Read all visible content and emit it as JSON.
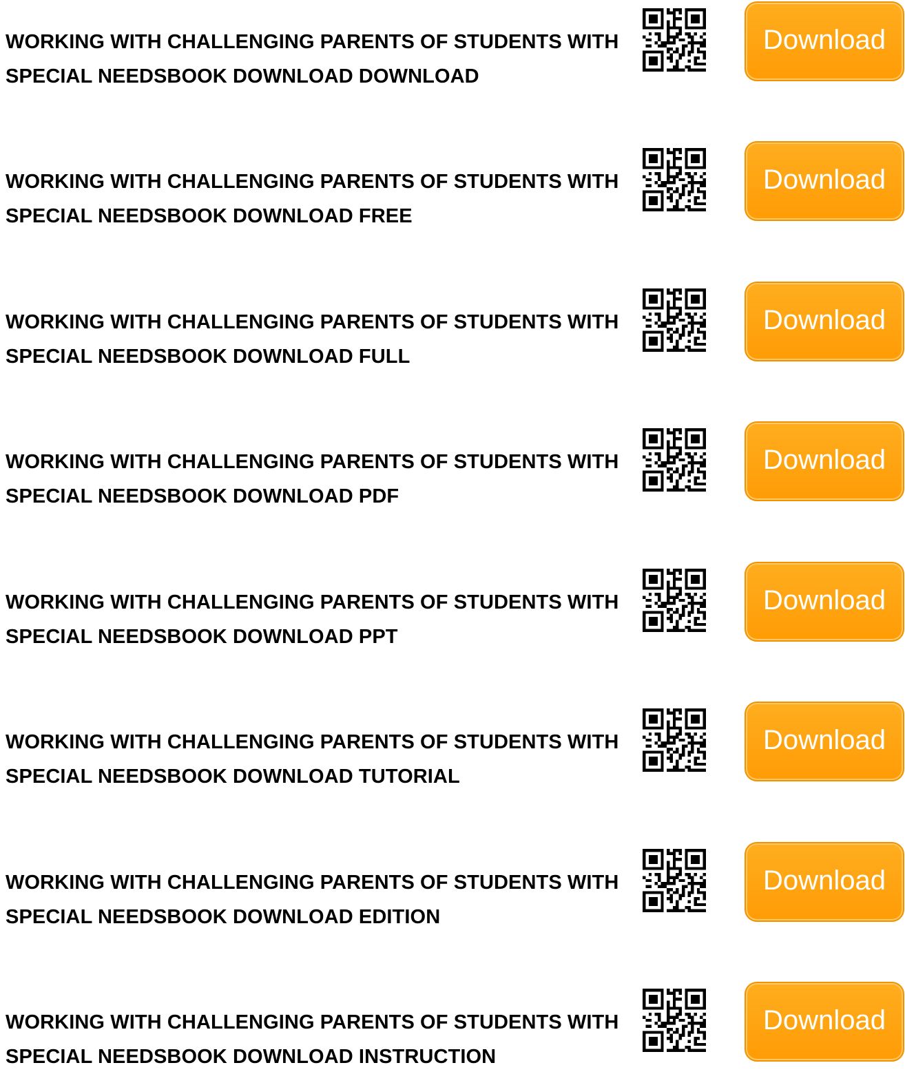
{
  "download_label": "Download",
  "accent_color": "#ff9f0a",
  "qr_icon": "qr-code-icon",
  "items": [
    {
      "title": "WORKING WITH CHALLENGING PARENTS OF STUDENTS WITH SPECIAL NEEDSBOOK DOWNLOAD DOWNLOAD"
    },
    {
      "title": "WORKING WITH CHALLENGING PARENTS OF STUDENTS WITH SPECIAL NEEDSBOOK DOWNLOAD FREE"
    },
    {
      "title": "WORKING WITH CHALLENGING PARENTS OF STUDENTS WITH SPECIAL NEEDSBOOK DOWNLOAD FULL"
    },
    {
      "title": "WORKING WITH CHALLENGING PARENTS OF STUDENTS WITH SPECIAL NEEDSBOOK DOWNLOAD PDF"
    },
    {
      "title": "WORKING WITH CHALLENGING PARENTS OF STUDENTS WITH SPECIAL NEEDSBOOK DOWNLOAD PPT"
    },
    {
      "title": "WORKING WITH CHALLENGING PARENTS OF STUDENTS WITH SPECIAL NEEDSBOOK DOWNLOAD TUTORIAL"
    },
    {
      "title": "WORKING WITH CHALLENGING PARENTS OF STUDENTS WITH SPECIAL NEEDSBOOK DOWNLOAD EDITION"
    },
    {
      "title": "WORKING WITH CHALLENGING PARENTS OF STUDENTS WITH SPECIAL NEEDSBOOK DOWNLOAD INSTRUCTION"
    }
  ]
}
